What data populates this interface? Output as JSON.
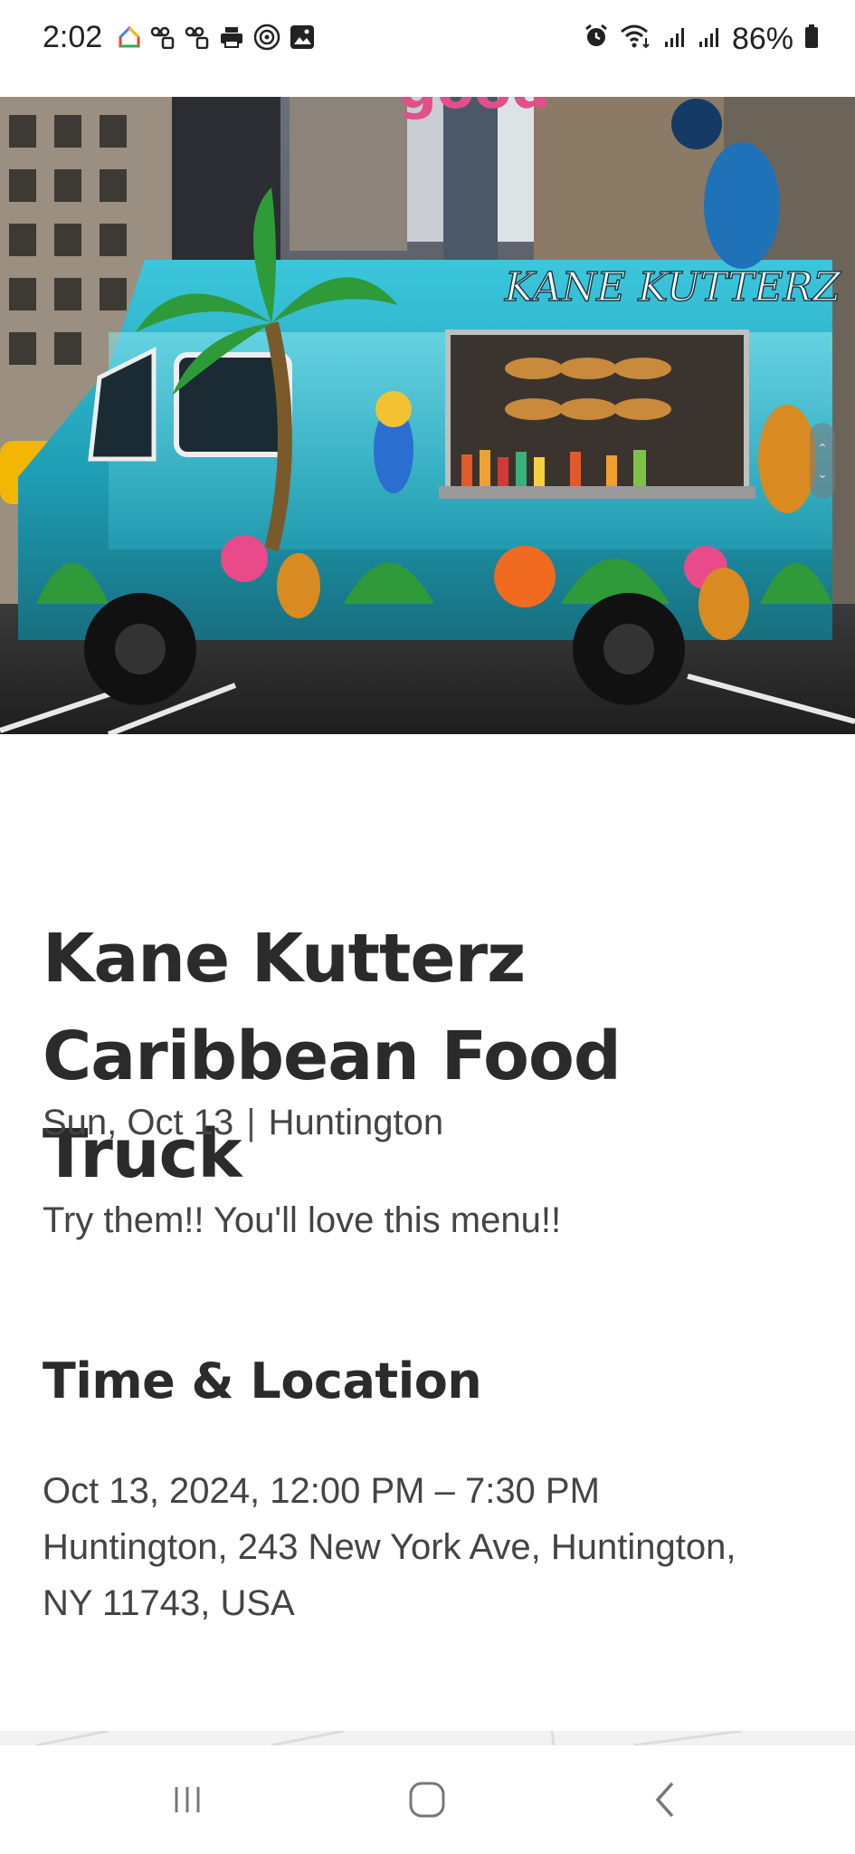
{
  "status_bar": {
    "time": "2:02",
    "battery": "86%",
    "left_icons": [
      "google-home-icon",
      "voicemail-icon",
      "voicemail-icon",
      "print-icon",
      "threads-icon",
      "gallery-icon"
    ],
    "right_icons": [
      "alarm-icon",
      "wifi-icon",
      "signal-icon",
      "signal-icon",
      "battery-icon"
    ]
  },
  "hero": {
    "truck_sign": "KANE KUTTERZ"
  },
  "event": {
    "title_line1": "Kane Kutterz",
    "title_line2": "Caribbean Food Truck",
    "date_short": "Sun, Oct 13",
    "separator": "|",
    "location_short": "Huntington",
    "description": "Try them!! You'll love this menu!!"
  },
  "time_location": {
    "heading": "Time & Location",
    "datetime": "Oct 13, 2024, 12:00 PM – 7:30 PM",
    "address_line1": "Huntington, 243 New York Ave, Huntington,",
    "address_line2": "NY 11743, USA"
  },
  "nav_bar": {
    "icons": [
      "recents-icon",
      "home-icon",
      "back-icon"
    ]
  },
  "colors": {
    "title_text": "#2b2b2b",
    "body_text": "#444444",
    "truck_teal": "#2ab3c9"
  }
}
